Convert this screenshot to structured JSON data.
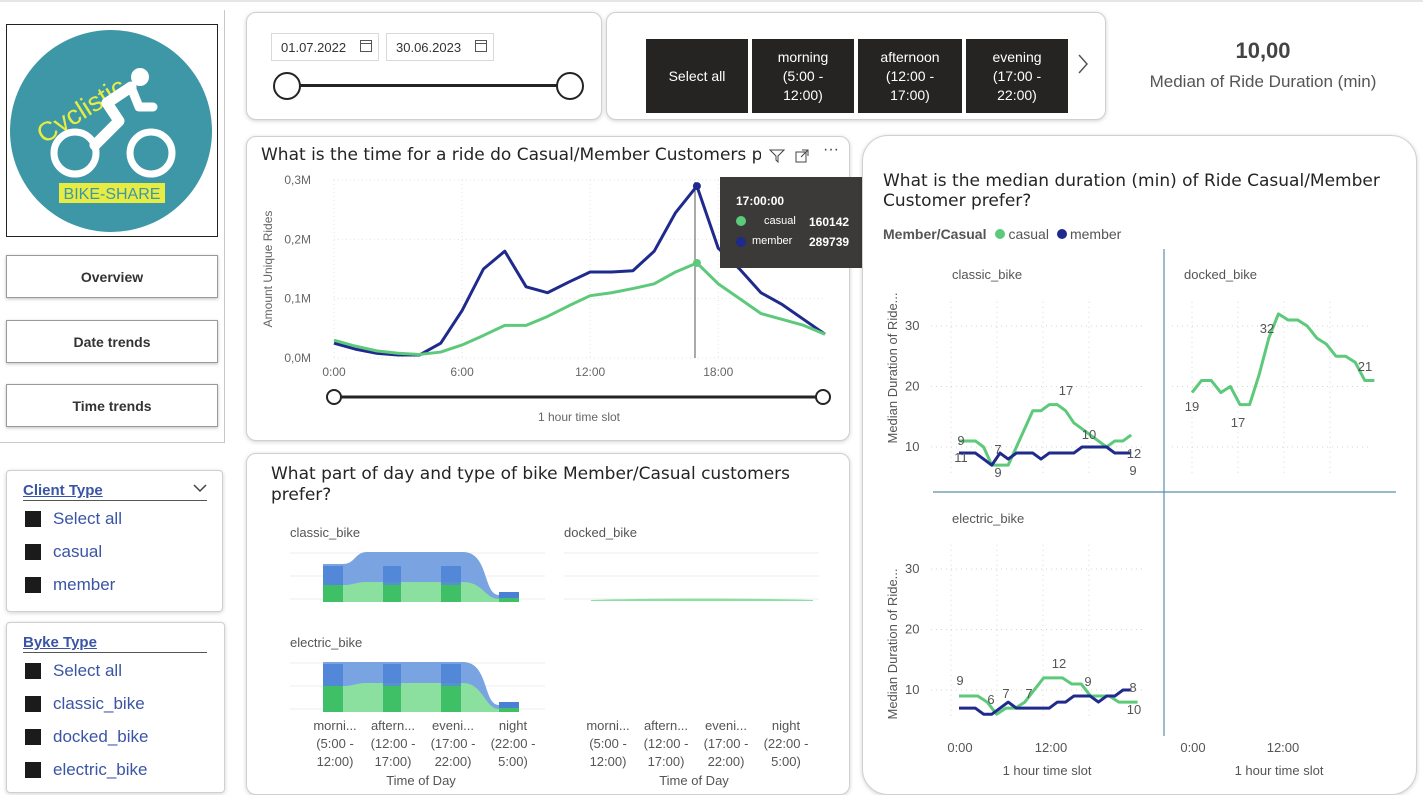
{
  "logo": {
    "line1": "Cyclistic",
    "line2": "BIKE-SHARE"
  },
  "nav": {
    "overview": "Overview",
    "date_trends": "Date trends",
    "time_trends": "Time trends"
  },
  "client_type": {
    "title": "Client Type",
    "items": [
      "Select all",
      "casual",
      "member"
    ]
  },
  "bike_type": {
    "title": "Byke Type",
    "items": [
      "Select all",
      "classic_bike",
      "docked_bike",
      "electric_bike"
    ]
  },
  "date_filter": {
    "start": "01.07.2022",
    "end": "30.06.2023"
  },
  "time_slicer": {
    "select_all": "Select all",
    "morning": [
      "morning",
      "(5:00 -",
      "12:00)"
    ],
    "afternoon": [
      "afternoon",
      "(12:00 -",
      "17:00)"
    ],
    "evening": [
      "evening",
      "(17:00 -",
      "22:00)"
    ]
  },
  "kpi": {
    "value": "10,00",
    "label": "Median of Ride Duration (min)"
  },
  "colors": {
    "casual": "#5dc97a",
    "member": "#1f2a8c",
    "dark": "#252423",
    "axis_line": "#5b8fa8"
  },
  "rides_chart": {
    "title": "What is the time for a ride do Casual/Member Customers pr",
    "ylabel": "Amount Unique Rides",
    "xlabel": "1 hour time slot",
    "yticks": [
      "0,3M",
      "0,2M",
      "0,1M",
      "0,0M"
    ],
    "xticks": [
      "0:00",
      "6:00",
      "12:00",
      "18:00"
    ],
    "tooltip": {
      "time": "17:00:00",
      "casual_label": "casual",
      "casual_value": "160142",
      "member_label": "member",
      "member_value": "289739"
    }
  },
  "chart_data": [
    {
      "type": "line",
      "title": "What is the time for a ride do Casual/Member Customers pr",
      "xlabel": "1 hour time slot",
      "ylabel": "Amount Unique Rides",
      "x": [
        0,
        1,
        2,
        3,
        4,
        5,
        6,
        7,
        8,
        9,
        10,
        11,
        12,
        13,
        14,
        15,
        16,
        17,
        18,
        19,
        20,
        21,
        22,
        23
      ],
      "ylim": [
        0,
        300000
      ],
      "series": [
        {
          "name": "member",
          "values": [
            25000,
            15000,
            8000,
            5000,
            5000,
            25000,
            80000,
            150000,
            180000,
            120000,
            110000,
            128000,
            145000,
            145000,
            147000,
            180000,
            245000,
            289739,
            185000,
            150000,
            110000,
            90000,
            65000,
            40000
          ]
        },
        {
          "name": "casual",
          "values": [
            30000,
            20000,
            12000,
            8000,
            6000,
            10000,
            22000,
            38000,
            55000,
            55000,
            70000,
            88000,
            105000,
            110000,
            117000,
            125000,
            145000,
            160142,
            125000,
            100000,
            75000,
            65000,
            55000,
            40000
          ]
        }
      ]
    },
    {
      "type": "area",
      "title": "What part of day and type of bike Member/Casual customers prefer?",
      "xlabel": "Time of Day",
      "categories": [
        "morni...\n(5:00 -\n12:00)",
        "aftern...\n(12:00 -\n17:00)",
        "eveni...\n(17:00 -\n22:00)",
        "night\n(22:00 -\n5:00)"
      ],
      "panels": [
        "classic_bike",
        "docked_bike",
        "electric_bike"
      ]
    },
    {
      "type": "line",
      "title": "What is the median duration (min) of Ride Casual/Member Customer prefer?",
      "legend_title": "Member/Casual",
      "legend": [
        "casual",
        "member"
      ],
      "ylabel": "Median Duration of Ride...",
      "xlabel": "1 hour time slot",
      "ylim": [
        0,
        35
      ],
      "panels": [
        {
          "name": "classic_bike",
          "casual": [
            11,
            11,
            11,
            10,
            7,
            7,
            7,
            10,
            13,
            16,
            16,
            17,
            17,
            16,
            14,
            13,
            12,
            11,
            10,
            11,
            11,
            12
          ],
          "member": [
            9,
            9,
            9,
            8,
            7,
            9,
            8,
            9,
            9,
            9,
            8,
            9,
            9,
            9,
            9,
            10,
            10,
            10,
            10,
            9,
            9,
            9
          ],
          "labels": {
            "casual": [
              "9",
              "7",
              "17",
              "10",
              "12"
            ],
            "member": [
              "11",
              "9",
              "9"
            ]
          }
        },
        {
          "name": "docked_bike",
          "casual": [
            19,
            21,
            21,
            19,
            20,
            17,
            17,
            22,
            28,
            32,
            31,
            31,
            30,
            28,
            27,
            25,
            25,
            24,
            21,
            21
          ],
          "labels": {
            "casual": [
              "19",
              "17",
              "32",
              "21"
            ]
          }
        },
        {
          "name": "electric_bike",
          "casual": [
            9,
            9,
            9,
            8,
            6,
            7,
            7,
            8,
            10,
            12,
            12,
            12,
            11,
            11,
            9,
            9,
            9,
            8,
            8,
            8
          ],
          "member": [
            7,
            7,
            7,
            6,
            6,
            7,
            8,
            7,
            7,
            7,
            7,
            7,
            8,
            8,
            9,
            9,
            9,
            8,
            9,
            9,
            10,
            10
          ],
          "labels": {
            "casual": [
              "9",
              "6",
              "7",
              "7",
              "12",
              "9",
              "8"
            ],
            "member": [
              "10"
            ]
          }
        }
      ],
      "xticks": [
        "0:00",
        "12:00"
      ]
    }
  ],
  "bike_part": {
    "title_l1": "What part of day and type of bike Member/Casual customers",
    "title_l2": "prefer?",
    "panels": [
      "classic_bike",
      "docked_bike",
      "electric_bike"
    ],
    "xcats": [
      [
        "morni...",
        "(5:00 -",
        "12:00)"
      ],
      [
        "aftern...",
        "(12:00 -",
        "17:00)"
      ],
      [
        "eveni...",
        "(17:00 -",
        "22:00)"
      ],
      [
        "night",
        "(22:00 -",
        "5:00)"
      ]
    ],
    "xlabel": "Time of Day"
  },
  "median_chart": {
    "title_l1": "What is the median duration (min) of Ride Casual/Member",
    "title_l2": "Customer prefer?",
    "legend_title": "Member/Casual",
    "legend_casual": "casual",
    "legend_member": "member",
    "panel_classic": "classic_bike",
    "panel_docked": "docked_bike",
    "panel_electric": "electric_bike",
    "ylabel": "Median Duration of Ride...",
    "yticks": [
      "30",
      "20",
      "10"
    ],
    "xticks": [
      "0:00",
      "12:00"
    ],
    "xlabel": "1 hour time slot"
  }
}
